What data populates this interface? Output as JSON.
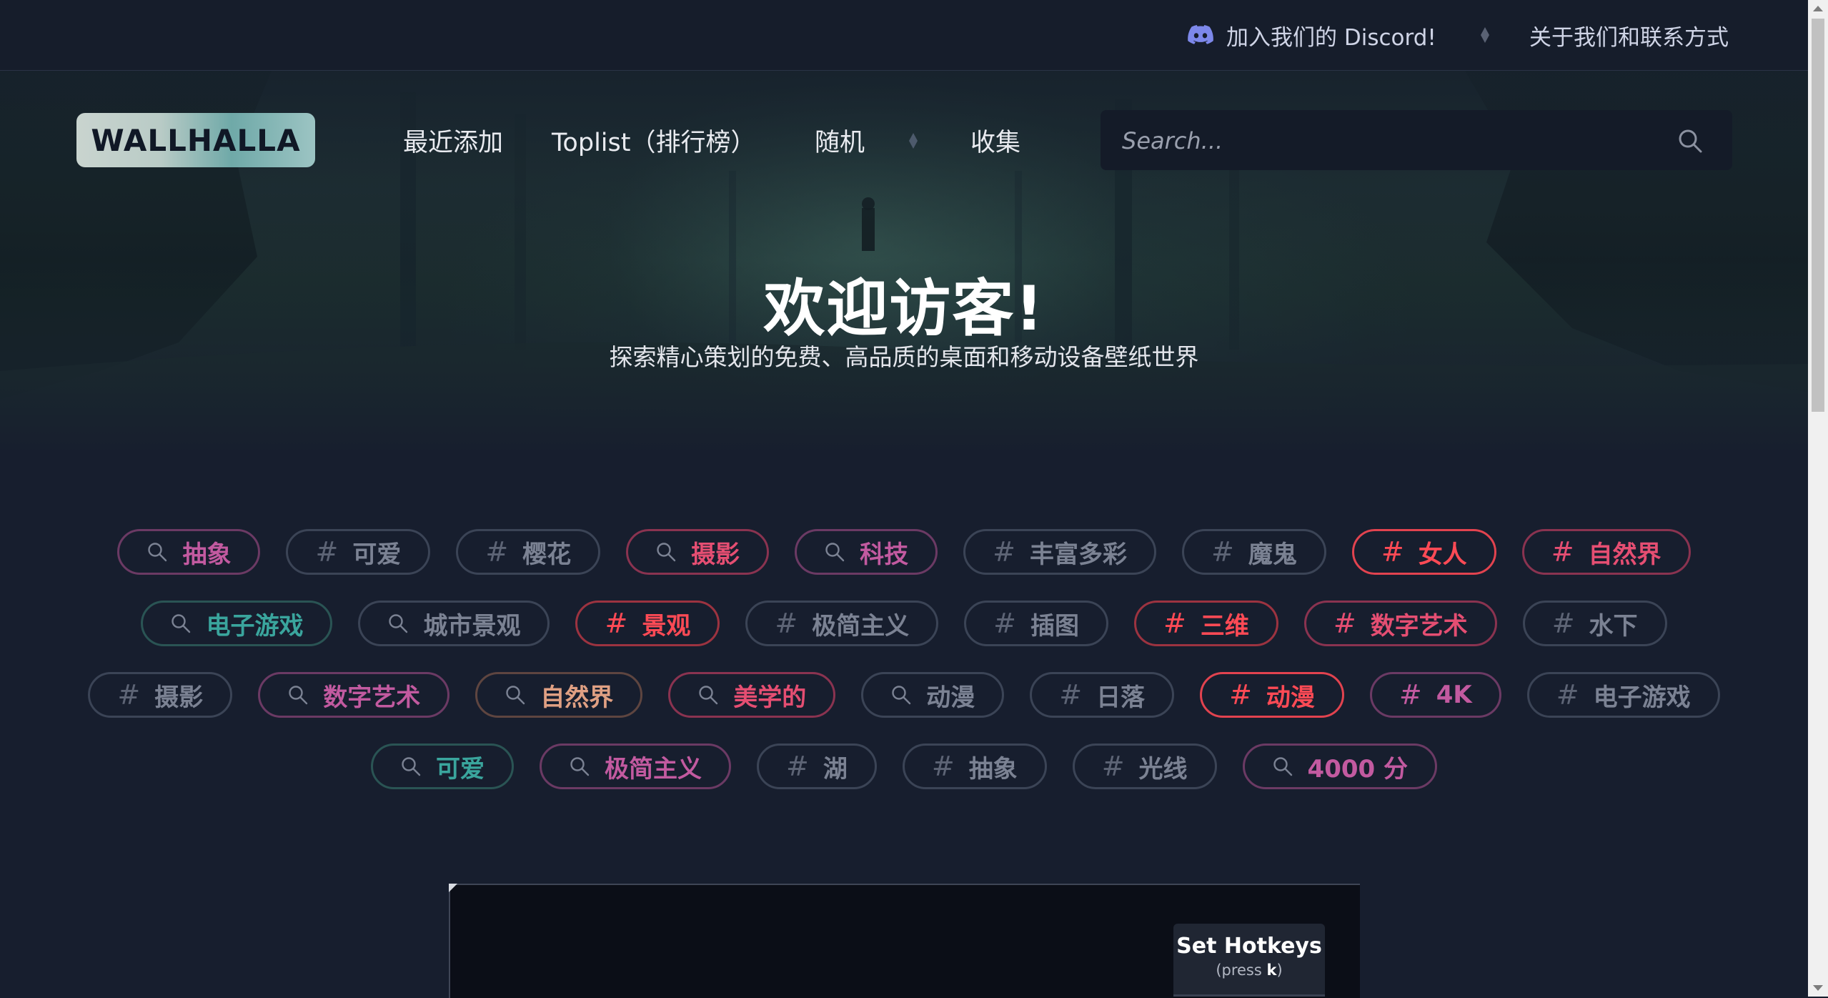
{
  "topbar": {
    "discord_label": "加入我们的 Discord!",
    "about_label": "关于我们和联系方式",
    "discord_color": "#7d88ea"
  },
  "header": {
    "logo_text": "WALLHALLA",
    "nav": [
      "最近添加",
      "Toplist（排行榜）",
      "随机",
      "收集"
    ],
    "search_placeholder": "Search..."
  },
  "hero": {
    "title": "欢迎访客!",
    "subtitle": "探索精心策划的免费、高品质的桌面和移动设备壁纸世界"
  },
  "tags": [
    [
      {
        "label": "抽象",
        "icon": "search-icon",
        "color": "#c25aa0",
        "border": "#6b3a64"
      },
      {
        "label": "可爱",
        "icon": "hash-icon",
        "color": "#7b8293",
        "border": "#3b4456"
      },
      {
        "label": "樱花",
        "icon": "hash-icon",
        "color": "#7b8293",
        "border": "#3b4456"
      },
      {
        "label": "摄影",
        "icon": "search-icon",
        "color": "#e54e72",
        "border": "#8a3350"
      },
      {
        "label": "科技",
        "icon": "search-icon",
        "color": "#c25aa0",
        "border": "#6b3a64"
      },
      {
        "label": "丰富多彩",
        "icon": "hash-icon",
        "color": "#7b8293",
        "border": "#3b4456"
      },
      {
        "label": "魔鬼",
        "icon": "hash-icon",
        "color": "#7b8293",
        "border": "#3b4456"
      },
      {
        "label": "女人",
        "icon": "hash-icon",
        "color": "#ff4a55",
        "border": "#e2434f"
      },
      {
        "label": "自然界",
        "icon": "hash-icon",
        "color": "#e54e72",
        "border": "#8a3350"
      }
    ],
    [
      {
        "label": "电子游戏",
        "icon": "search-icon",
        "color": "#3aa59d",
        "border": "#2a5454"
      },
      {
        "label": "城市景观",
        "icon": "search-icon",
        "color": "#7b8293",
        "border": "#3b4456"
      },
      {
        "label": "景观",
        "icon": "hash-icon",
        "color": "#ff4a55",
        "border": "#9c3340"
      },
      {
        "label": "极简主义",
        "icon": "hash-icon",
        "color": "#7b8293",
        "border": "#3b4456"
      },
      {
        "label": "插图",
        "icon": "hash-icon",
        "color": "#7b8293",
        "border": "#3b4456"
      },
      {
        "label": "三维",
        "icon": "hash-icon",
        "color": "#ff4a55",
        "border": "#9c3340"
      },
      {
        "label": "数字艺术",
        "icon": "hash-icon",
        "color": "#e54e72",
        "border": "#8a3350"
      },
      {
        "label": "水下",
        "icon": "hash-icon",
        "color": "#7b8293",
        "border": "#3b4456"
      }
    ],
    [
      {
        "label": "摄影",
        "icon": "hash-icon",
        "color": "#7b8293",
        "border": "#3b4456"
      },
      {
        "label": "数字艺术",
        "icon": "search-icon",
        "color": "#c25aa0",
        "border": "#6b3a64"
      },
      {
        "label": "自然界",
        "icon": "search-icon",
        "color": "#e0a083",
        "border": "#5e4540"
      },
      {
        "label": "美学的",
        "icon": "search-icon",
        "color": "#e54e72",
        "border": "#8a3350"
      },
      {
        "label": "动漫",
        "icon": "search-icon",
        "color": "#7b8293",
        "border": "#3b4456"
      },
      {
        "label": "日落",
        "icon": "hash-icon",
        "color": "#7b8293",
        "border": "#3b4456"
      },
      {
        "label": "动漫",
        "icon": "hash-icon",
        "color": "#ff4a55",
        "border": "#e2434f"
      },
      {
        "label": "4K",
        "icon": "hash-icon",
        "color": "#c25aa0",
        "border": "#6b3a64"
      },
      {
        "label": "电子游戏",
        "icon": "hash-icon",
        "color": "#7b8293",
        "border": "#3b4456"
      }
    ],
    [
      {
        "label": "可爱",
        "icon": "search-icon",
        "color": "#3aa59d",
        "border": "#2a5454"
      },
      {
        "label": "极简主义",
        "icon": "search-icon",
        "color": "#c25aa0",
        "border": "#6b3a64"
      },
      {
        "label": "湖",
        "icon": "hash-icon",
        "color": "#7b8293",
        "border": "#3b4456"
      },
      {
        "label": "抽象",
        "icon": "hash-icon",
        "color": "#7b8293",
        "border": "#3b4456"
      },
      {
        "label": "光线",
        "icon": "hash-icon",
        "color": "#7b8293",
        "border": "#3b4456"
      },
      {
        "label": "4000 分",
        "icon": "search-icon",
        "color": "#c25aa0",
        "border": "#6b3a64"
      }
    ]
  ],
  "hotkeys": {
    "title": "Set Hotkeys",
    "hint_prefix": "(press ",
    "hint_key": "k",
    "hint_suffix": ")"
  }
}
